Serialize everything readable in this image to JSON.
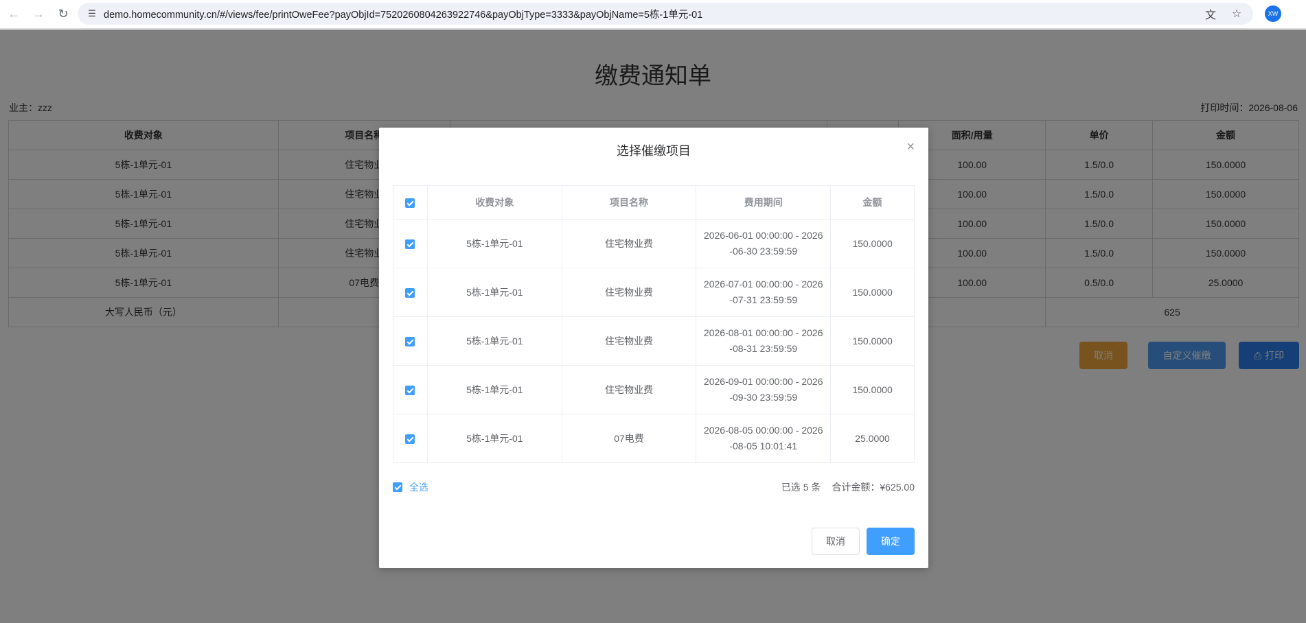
{
  "browser": {
    "url": "demo.homecommunity.cn/#/views/fee/printOweFee?payObjId=752026080426392274​6&payObjType=3333&payObjName=5栋-1单元-01",
    "avatar_text": "XW"
  },
  "page": {
    "title": "缴费通知单",
    "owner": "业主：zzz",
    "print_time": "打印时间：2026-08-06",
    "table": {
      "headers": [
        "收费对象",
        "项目名称",
        "",
        "",
        "面积/用量",
        "单价",
        "金额"
      ],
      "rows": [
        [
          "5栋-1单元-01",
          "住宅物业",
          "",
          "",
          "100.00",
          "1.5/0.0",
          "150.0000"
        ],
        [
          "5栋-1单元-01",
          "住宅物业",
          "",
          "",
          "100.00",
          "1.5/0.0",
          "150.0000"
        ],
        [
          "5栋-1单元-01",
          "住宅物业",
          "",
          "",
          "100.00",
          "1.5/0.0",
          "150.0000"
        ],
        [
          "5栋-1单元-01",
          "住宅物业",
          "",
          "",
          "100.00",
          "1.5/0.0",
          "150.0000"
        ],
        [
          "5栋-1单元-01",
          "07电费",
          "",
          "",
          "100.00",
          "0.5/0.0",
          "25.0000"
        ]
      ],
      "total_label": "大写人民币（元）",
      "total_value": "625"
    },
    "buttons": {
      "cancel": "取消",
      "custom": "自定义催缴",
      "print": "打印"
    }
  },
  "modal": {
    "title": "选择催缴项目",
    "columns": [
      "收费对象",
      "项目名称",
      "费用期间",
      "金额"
    ],
    "rows": [
      {
        "object": "5栋-1单元-01",
        "item": "住宅物业费",
        "period_a": "2026-06-01 00:00:00 - 2026",
        "period_b": "-06-30 23:59:59",
        "amount": "150.0000"
      },
      {
        "object": "5栋-1单元-01",
        "item": "住宅物业费",
        "period_a": "2026-07-01 00:00:00 - 2026",
        "period_b": "-07-31 23:59:59",
        "amount": "150.0000"
      },
      {
        "object": "5栋-1单元-01",
        "item": "住宅物业费",
        "period_a": "2026-08-01 00:00:00 - 2026",
        "period_b": "-08-31 23:59:59",
        "amount": "150.0000"
      },
      {
        "object": "5栋-1单元-01",
        "item": "住宅物业费",
        "period_a": "2026-09-01 00:00:00 - 2026",
        "period_b": "-09-30 23:59:59",
        "amount": "150.0000"
      },
      {
        "object": "5栋-1单元-01",
        "item": "07电费",
        "period_a": "2026-08-05 00:00:00 - 2026",
        "period_b": "-08-05 10:01:41",
        "amount": "25.0000"
      }
    ],
    "select_all": "全选",
    "selected_count": "已选 5 条",
    "total": "合计金额：¥625.00",
    "cancel": "取消",
    "confirm": "确定"
  }
}
